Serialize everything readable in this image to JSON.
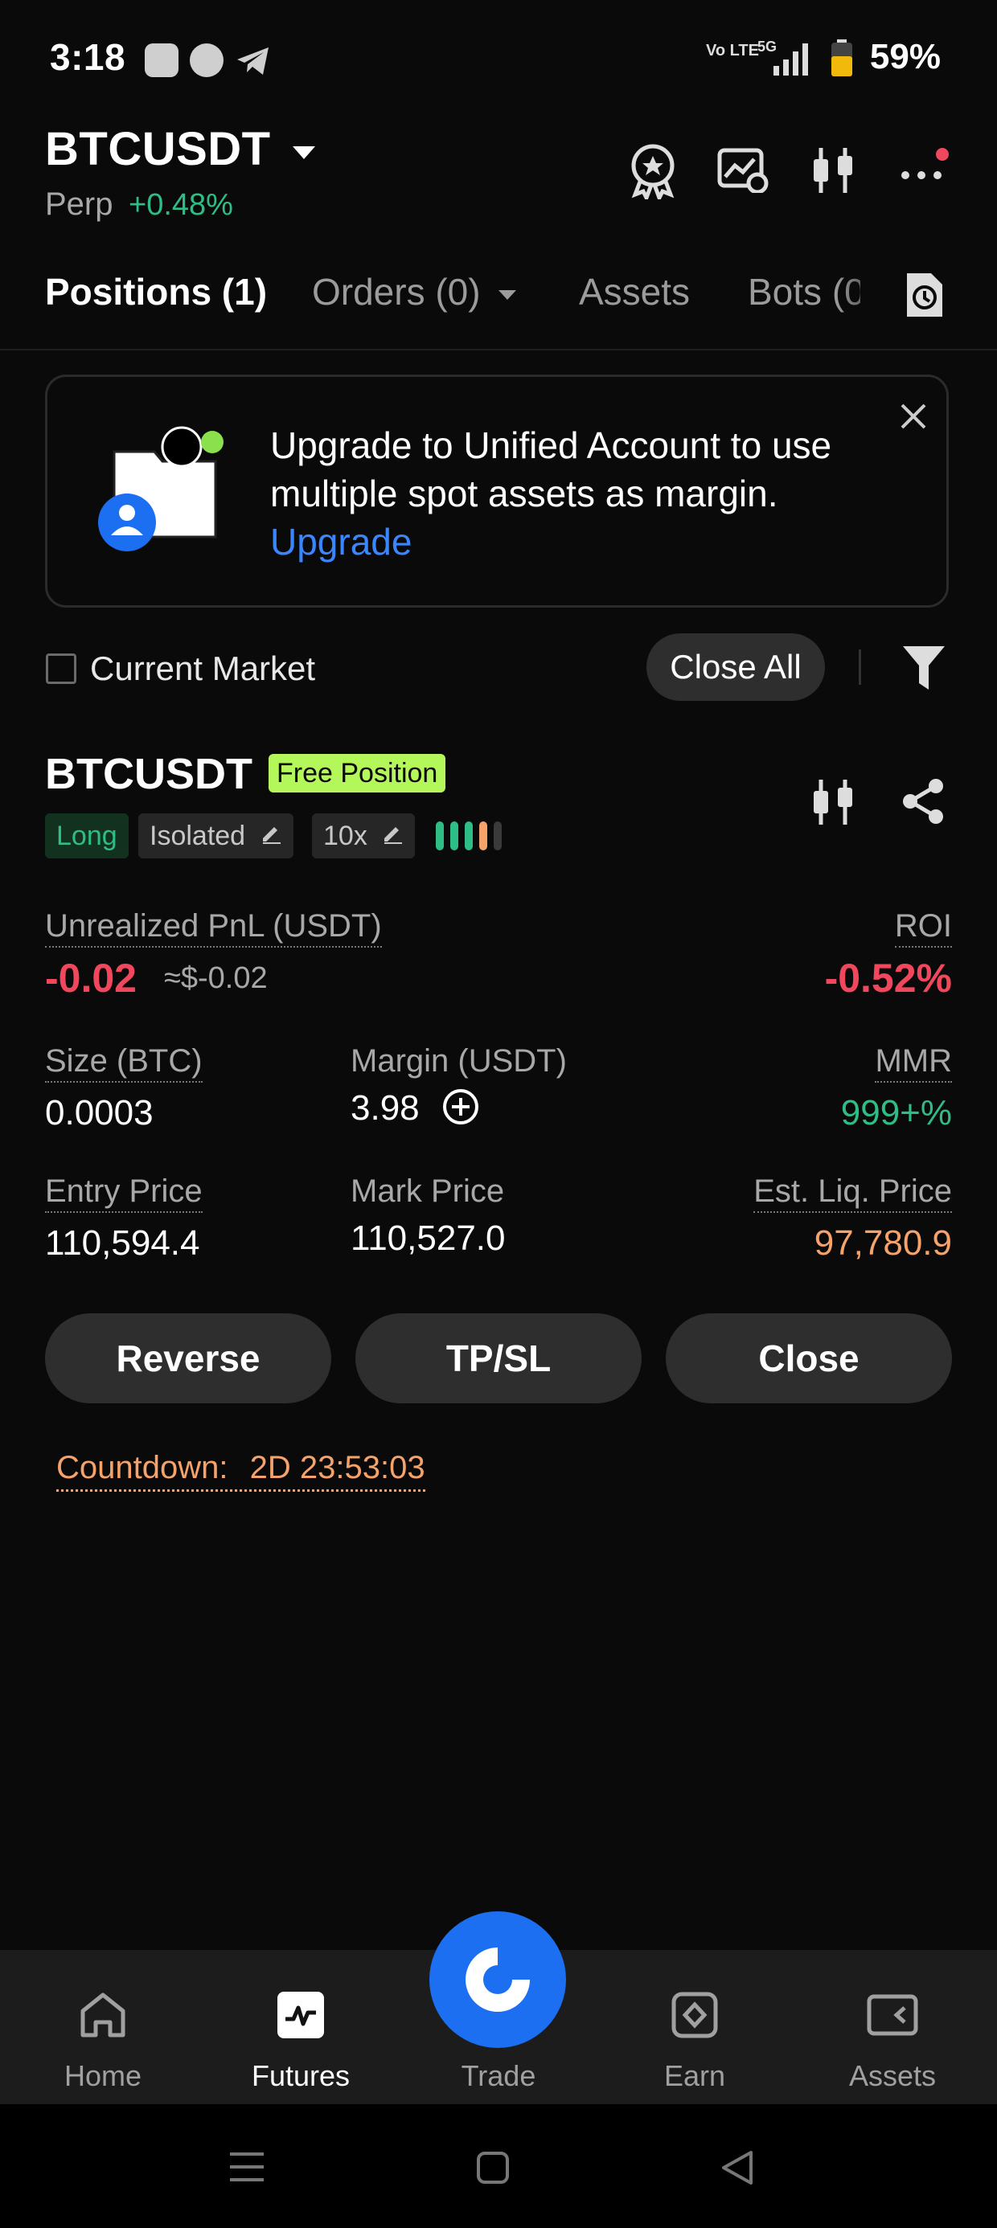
{
  "status_bar": {
    "time": "3:18",
    "signal_text": "Vo LTE",
    "network": "5G",
    "battery": "59%"
  },
  "header": {
    "pair": "BTCUSDT",
    "contract_type": "Perp",
    "change": "+0.48%",
    "icons": [
      "badge-icon",
      "chart-settings-icon",
      "candlestick-icon",
      "more-icon"
    ]
  },
  "tabs": {
    "positions": "Positions (1)",
    "orders": "Orders (0)",
    "assets": "Assets",
    "bots": "Bots (0"
  },
  "banner": {
    "text": "Upgrade to Unified Account to use multiple spot assets as margin.",
    "link": "Upgrade"
  },
  "filter": {
    "current_market_label": "Current Market",
    "close_all_label": "Close All"
  },
  "position": {
    "symbol": "BTCUSDT",
    "badge": "Free Position",
    "side": "Long",
    "margin_mode": "Isolated",
    "leverage": "10x",
    "risk_level": 4,
    "unrealized_pnl_label": "Unrealized PnL (USDT)",
    "unrealized_pnl": "-0.02",
    "unrealized_pnl_usd": "≈$-0.02",
    "roi_label": "ROI",
    "roi": "-0.52%",
    "size_label": "Size (BTC)",
    "size": "0.0003",
    "margin_label": "Margin (USDT)",
    "margin": "3.98",
    "mmr_label": "MMR",
    "mmr": "999+%",
    "entry_price_label": "Entry Price",
    "entry_price": "110,594.4",
    "mark_price_label": "Mark Price",
    "mark_price": "110,527.0",
    "liq_price_label": "Est. Liq. Price",
    "liq_price": "97,780.9"
  },
  "actions": {
    "reverse": "Reverse",
    "tpsl": "TP/SL",
    "close": "Close"
  },
  "countdown": {
    "label": "Countdown:",
    "value": "2D 23:53:03"
  },
  "bottom_nav": {
    "home": "Home",
    "futures": "Futures",
    "trade": "Trade",
    "earn": "Earn",
    "assets": "Assets"
  },
  "colors": {
    "background": "#0a0a0a",
    "positive": "#2fbd86",
    "negative": "#f0475d",
    "warning": "#f5a36b",
    "accent": "#1d6ff2",
    "badge": "#b4f75a"
  }
}
